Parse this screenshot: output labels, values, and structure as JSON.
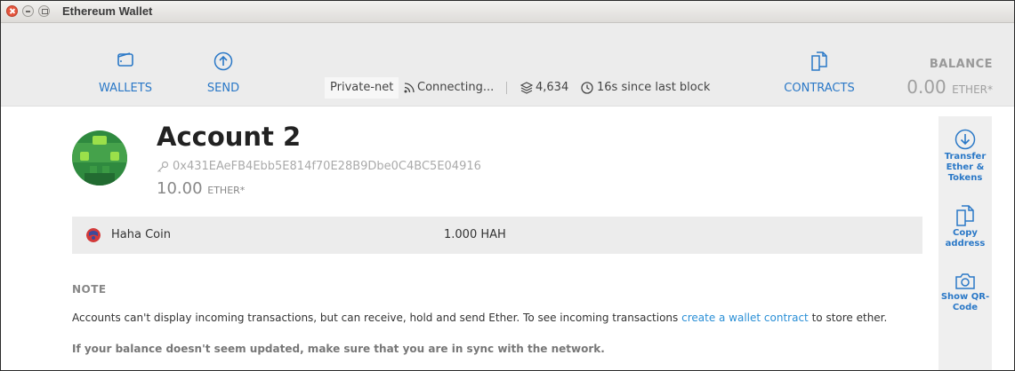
{
  "window": {
    "title": "Ethereum Wallet"
  },
  "nav": {
    "wallets_label": "WALLETS",
    "send_label": "SEND",
    "contracts_label": "CONTRACTS"
  },
  "status": {
    "network": "Private-net",
    "connection": "Connecting...",
    "block_count": "4,634",
    "last_block": "16s since last block"
  },
  "balance": {
    "title": "BALANCE",
    "value": "0.00",
    "unit": "ETHER*"
  },
  "account": {
    "name": "Account 2",
    "address": "0x431EAeFB4Ebb5E814f70E28B9Dbe0C4BC5E04916",
    "balance": "10.00",
    "unit": "ETHER*"
  },
  "tokens": [
    {
      "name": "Haha Coin",
      "amount": "1.000 HAH"
    }
  ],
  "note": {
    "title": "NOTE",
    "text_before": "Accounts can't display incoming transactions, but can receive, hold and send Ether. To see incoming transactions ",
    "link": "create a wallet contract",
    "text_after": " to store ether.",
    "sync": "If your balance doesn't seem updated, make sure that you are in sync with the network."
  },
  "sidebar": {
    "transfer": "Transfer\nEther &\nTokens",
    "copy": "Copy\naddress",
    "qr": "Show QR-\nCode"
  },
  "colors": {
    "accent": "#2a78c7",
    "link": "#2a8fd6",
    "header_bg": "#ececec"
  },
  "icons": [
    "wallet-icon",
    "send-icon",
    "contracts-icon",
    "connecting-icon",
    "blocks-icon",
    "clock-icon",
    "key-icon",
    "transfer-icon",
    "copy-icon",
    "camera-icon"
  ]
}
